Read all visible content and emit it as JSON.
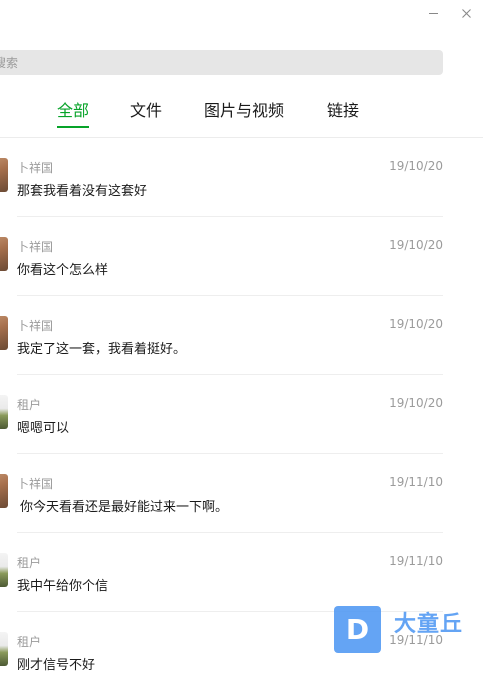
{
  "window": {
    "minimize_icon": "minimize-icon",
    "close_icon": "close-icon"
  },
  "search": {
    "placeholder": "搜索",
    "visible_text": "搜索"
  },
  "tabs": [
    {
      "label": "全部",
      "active": true
    },
    {
      "label": "文件",
      "active": false
    },
    {
      "label": "图片与视频",
      "active": false
    },
    {
      "label": "链接",
      "active": false
    }
  ],
  "colors": {
    "accent": "#07a329",
    "muted_text": "#9b9b9b",
    "search_bg": "#e6e6e6",
    "watermark": "#4f98f3"
  },
  "messages": [
    {
      "sender": "卜祥国",
      "date": "19/10/20",
      "text": "那套我看着没有这套好",
      "avatar": "person"
    },
    {
      "sender": "卜祥国",
      "date": "19/10/20",
      "text": "你看这个怎么样",
      "avatar": "person"
    },
    {
      "sender": "卜祥国",
      "date": "19/10/20",
      "text": "我定了这一套，我看着挺好。",
      "avatar": "person"
    },
    {
      "sender": "租户",
      "date": "19/10/20",
      "text": "嗯嗯可以",
      "avatar": "scene"
    },
    {
      "sender": "卜祥国",
      "date": "19/11/10",
      "text": "你今天看看还是最好能过来一下啊。",
      "avatar": "person"
    },
    {
      "sender": "租户",
      "date": "19/11/10",
      "text": "我中午给你个信",
      "avatar": "scene"
    },
    {
      "sender": "租户",
      "date": "19/11/10",
      "text": "刚才信号不好",
      "avatar": "scene"
    }
  ],
  "watermark": {
    "logo": "D",
    "text": "大童丘"
  }
}
